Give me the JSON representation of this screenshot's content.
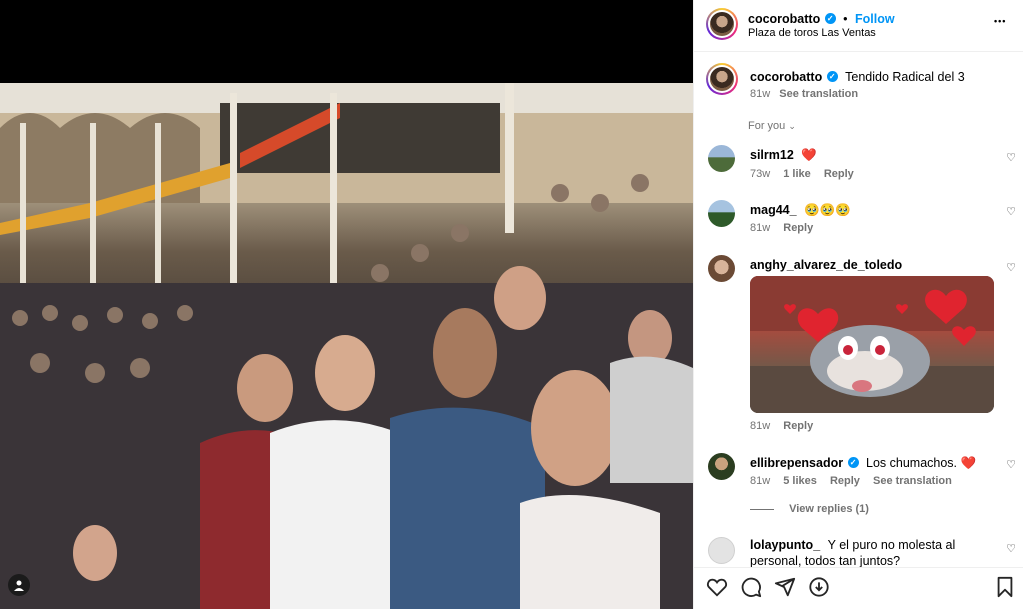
{
  "post": {
    "username": "cocorobatto",
    "follow_label": "Follow",
    "separator": "•",
    "location": "Plaza de toros Las Ventas",
    "more_label": "•••",
    "caption": "Tendido Radical del 3",
    "caption_time": "81w",
    "see_translation": "See translation",
    "sort_label": "For you"
  },
  "comments": [
    {
      "username": "silrm12",
      "text": "❤️",
      "time": "73w",
      "likes": "1 like",
      "reply": "Reply"
    },
    {
      "username": "mag44_",
      "text": "🥹🥹🥹",
      "time": "81w",
      "reply": "Reply"
    },
    {
      "username": "anghy_alvarez_de_toledo",
      "text": "",
      "time": "81w",
      "reply": "Reply"
    },
    {
      "username": "ellibrepensador",
      "text": "Los chumachos. ❤️",
      "time": "81w",
      "likes": "5 likes",
      "reply": "Reply",
      "see_translation": "See translation",
      "view_replies": "View replies (1)"
    },
    {
      "username": "lolaypunto_",
      "text": "Y el puro no molesta al personal, todos tan juntos?"
    }
  ],
  "colors": {
    "accent": "#0095f6",
    "muted": "#737373",
    "heart": "#ed4956"
  },
  "icons": [
    "heart-icon",
    "comment-icon",
    "share-icon",
    "save-icon",
    "bookmark-icon",
    "tag-user-icon"
  ]
}
